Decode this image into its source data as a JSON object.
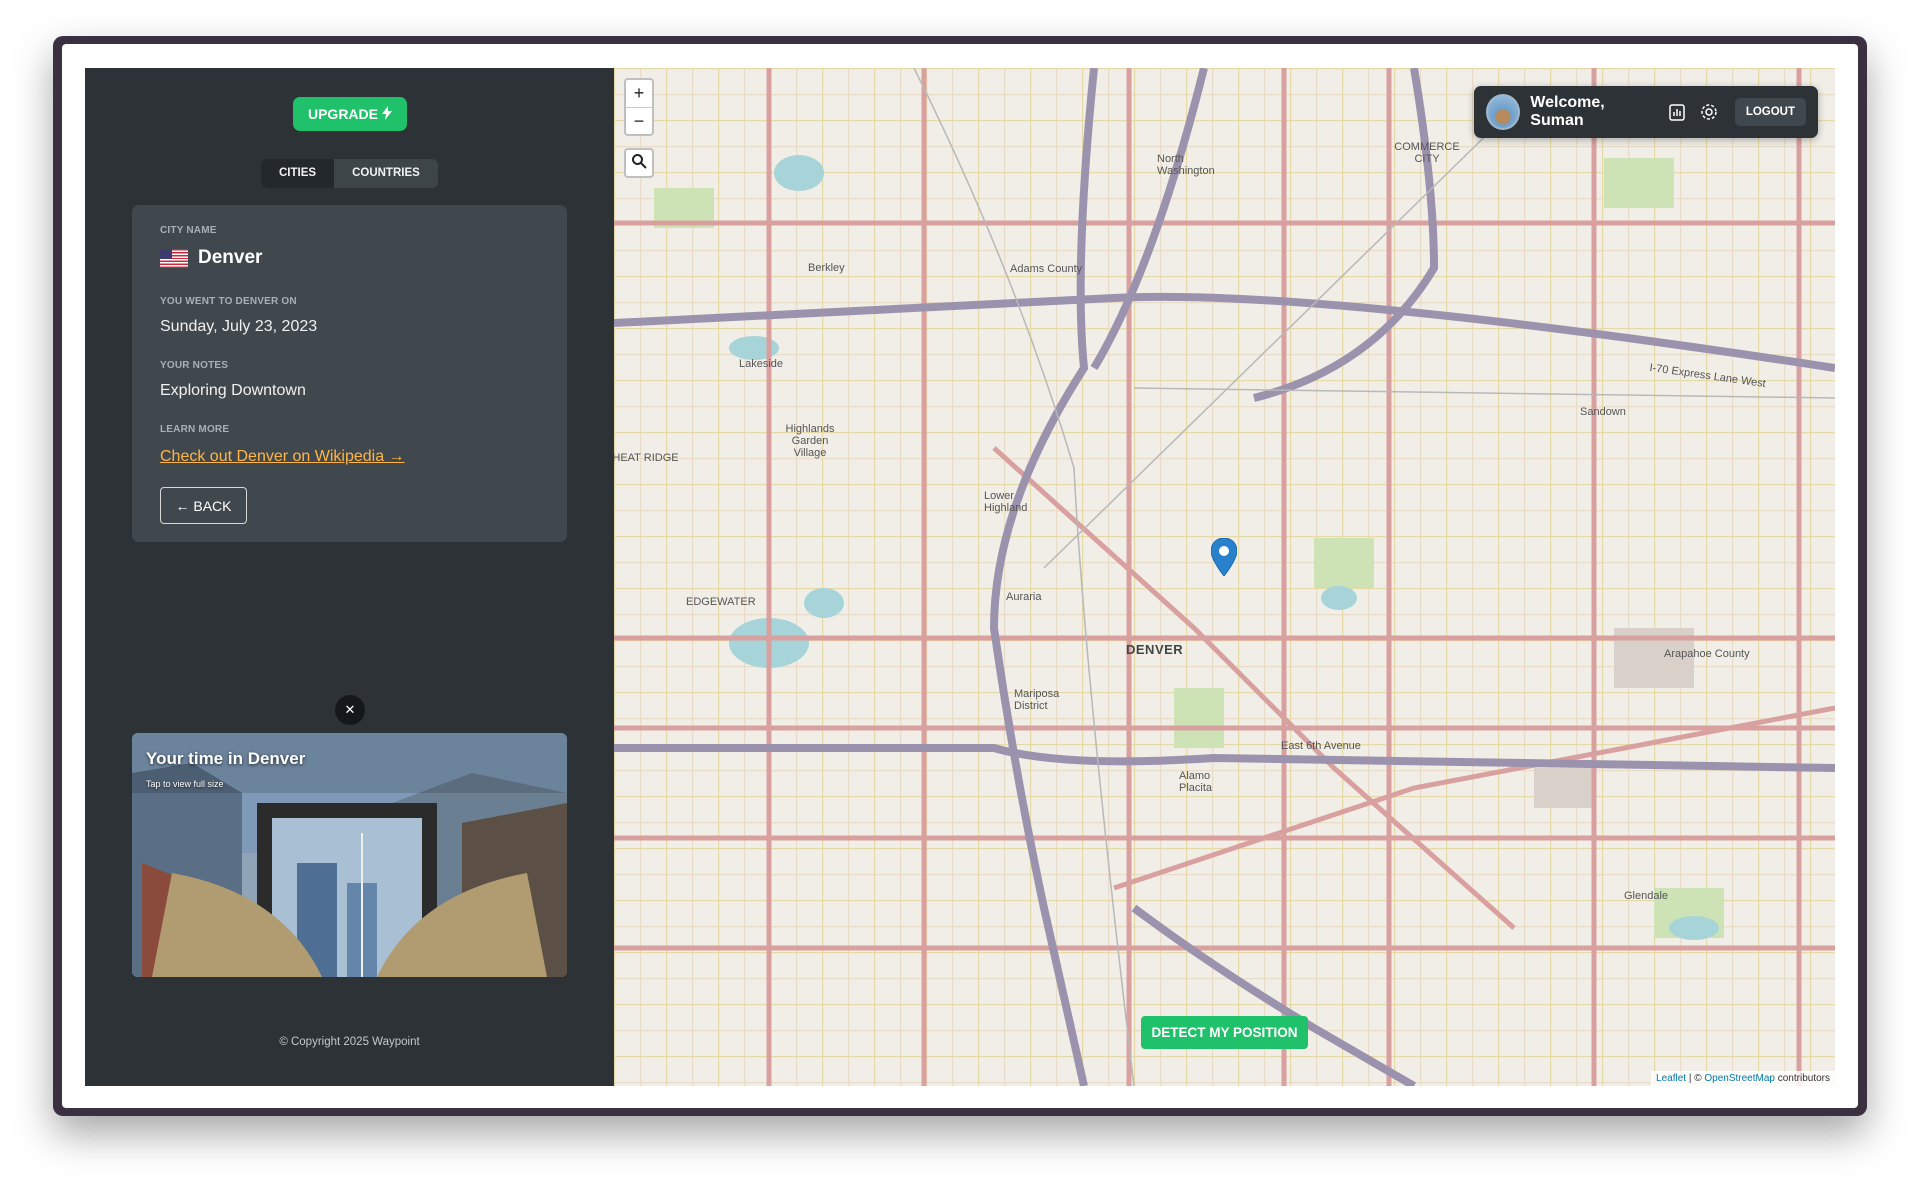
{
  "sidebar": {
    "upgrade_label": "UPGRADE",
    "upgrade_icon": "lightning-icon",
    "tabs": [
      {
        "label": "CITIES",
        "active": true
      },
      {
        "label": "COUNTRIES",
        "active": false
      }
    ],
    "card": {
      "city_label": "CITY NAME",
      "flag_icon": "us-flag-icon",
      "city_name": "Denver",
      "visit_label": "YOU WENT TO DENVER ON",
      "visit_date": "Sunday, July 23, 2023",
      "notes_label": "YOUR NOTES",
      "notes": "Exploring Downtown",
      "learn_label": "LEARN MORE",
      "wiki_link": "Check out Denver on Wikipedia →",
      "back_label": "← BACK"
    },
    "photo": {
      "close_icon": "close-icon",
      "title": "Your time in Denver",
      "subtitle": "Tap to view full size"
    },
    "copyright": "© Copyright 2025 Waypoint"
  },
  "map": {
    "zoom_in": "+",
    "zoom_out": "−",
    "search_icon": "search-icon",
    "user": {
      "welcome": "Welcome, Suman",
      "stats_icon": "chart-icon",
      "settings_icon": "gear-icon",
      "logout_label": "LOGOUT"
    },
    "detect_label": "DETECT MY POSITION",
    "attribution_leaflet": "Leaflet",
    "attribution_sep": " | © ",
    "attribution_osm": "OpenStreetMap",
    "attribution_tail": " contributors",
    "labels": [
      {
        "text": "DENVER",
        "big": true
      },
      {
        "text": "COMMERCE CITY",
        "big": false
      },
      {
        "text": "EDGEWATER",
        "big": false
      },
      {
        "text": "WHEAT RIDGE",
        "big": false
      },
      {
        "text": "East 6th Avenue",
        "big": false
      },
      {
        "text": "I-70 Express Lane West",
        "big": false
      },
      {
        "text": "Adams County",
        "big": false
      },
      {
        "text": "Arapahoe County",
        "big": false
      },
      {
        "text": "Glendale",
        "big": false
      },
      {
        "text": "North Washington",
        "big": false
      },
      {
        "text": "Highlands Garden Village",
        "big": false
      },
      {
        "text": "Lower Highland",
        "big": false
      },
      {
        "text": "Auraria",
        "big": false
      },
      {
        "text": "Mariposa District",
        "big": false
      },
      {
        "text": "Alamo Placita",
        "big": false
      },
      {
        "text": "Sandown",
        "big": false
      },
      {
        "text": "Berkley",
        "big": false
      },
      {
        "text": "Lakeside",
        "big": false
      }
    ],
    "colors": {
      "primary_road": "#d9a0a0",
      "highway": "#9b93ad",
      "water": "#a6d4d8",
      "park": "#cde3b5"
    }
  },
  "colors": {
    "sidebar_bg": "#2c3236",
    "card_bg": "#41484d",
    "accent_green": "#1fc16b",
    "link_orange": "#ffb545"
  }
}
